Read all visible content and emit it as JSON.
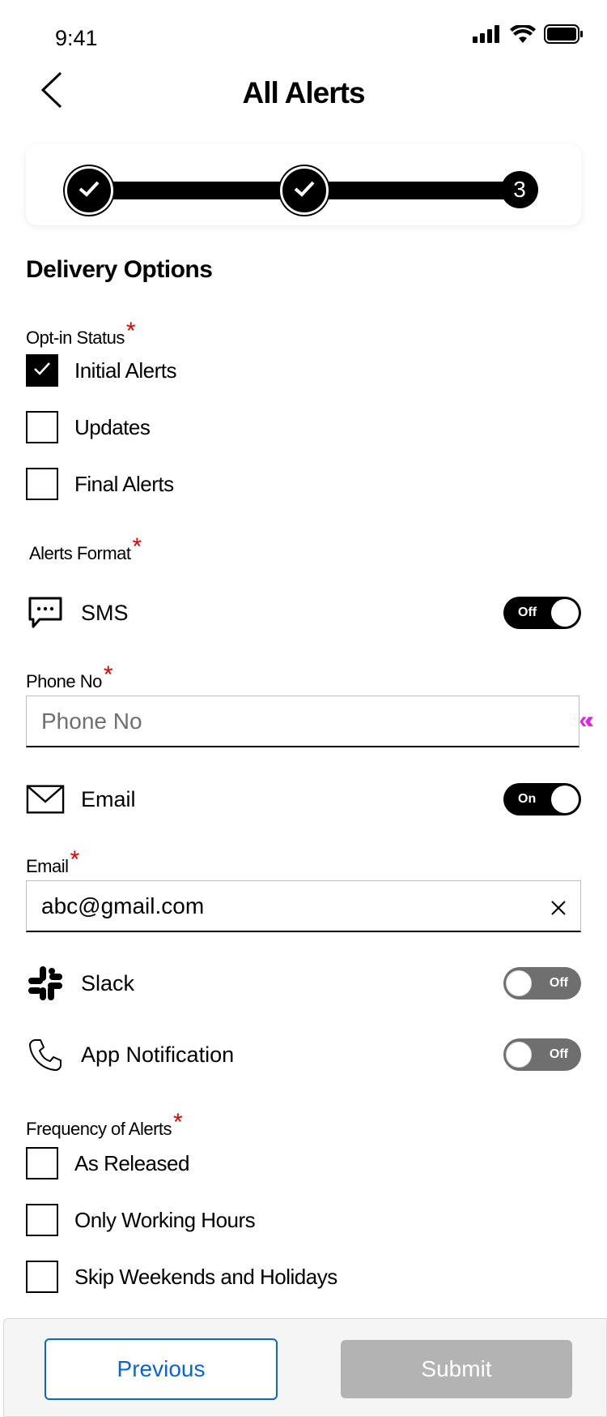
{
  "status_bar": {
    "time": "9:41"
  },
  "header": {
    "title": "All Alerts"
  },
  "stepper": {
    "current_step": "3"
  },
  "section_title": "Delivery Options",
  "opt_in": {
    "label": "Opt-in Status",
    "required_mark": "*",
    "options": [
      {
        "label": "Initial Alerts",
        "checked": true
      },
      {
        "label": "Updates",
        "checked": false
      },
      {
        "label": "Final Alerts",
        "checked": false
      }
    ]
  },
  "alerts_format": {
    "label": "Alerts Format",
    "required_mark": "*",
    "sms": {
      "label": "SMS",
      "toggle": "Off"
    },
    "phone": {
      "label": "Phone No",
      "required_mark": "*",
      "placeholder": "Phone No",
      "value": ""
    },
    "email": {
      "label": "Email",
      "toggle": "On"
    },
    "email_field": {
      "label": "Email",
      "required_mark": "*",
      "value": "abc@gmail.com"
    },
    "slack": {
      "label": "Slack",
      "toggle": "Off"
    },
    "app_notification": {
      "label": "App Notification",
      "toggle": "Off"
    }
  },
  "frequency": {
    "label": "Frequency of Alerts",
    "required_mark": "*",
    "options": [
      {
        "label": "As Released",
        "checked": false
      },
      {
        "label": "Only Working Hours",
        "checked": false
      },
      {
        "label": "Skip Weekends and Holidays",
        "checked": false
      }
    ]
  },
  "footer": {
    "previous_label": "Previous",
    "submit_label": "Submit"
  },
  "colors": {
    "required": "#e00000",
    "primary_blue": "#0a66d4",
    "disabled": "#b3b3b3"
  }
}
